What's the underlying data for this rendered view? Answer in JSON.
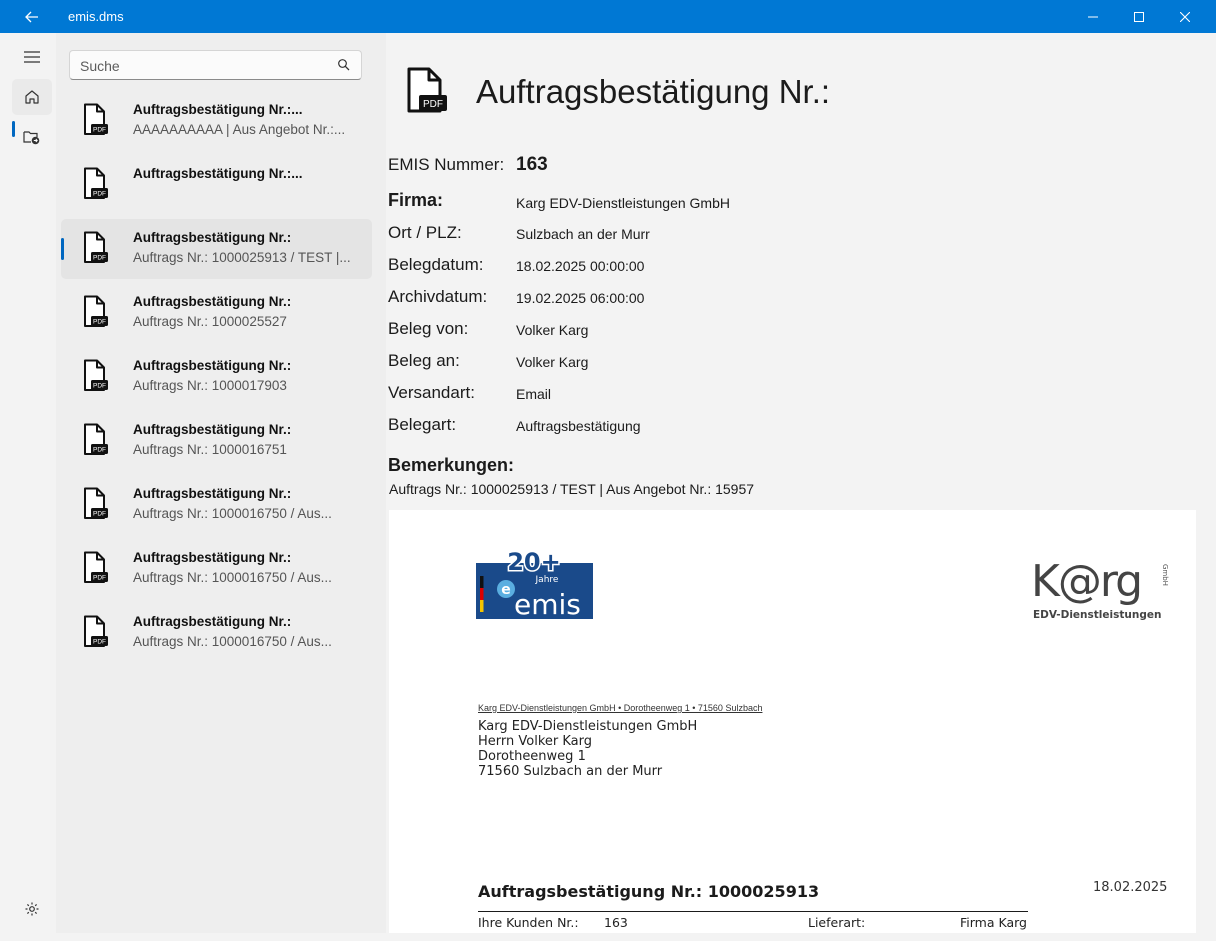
{
  "window": {
    "title": "emis.dms"
  },
  "search": {
    "placeholder": "Suche"
  },
  "list": [
    {
      "title": "Auftragsbestätigung Nr.:...",
      "subtitle": "AAAAAAAAAA | Aus Angebot Nr.:..."
    },
    {
      "title": "Auftragsbestätigung Nr.:...",
      "subtitle": ""
    },
    {
      "title": "Auftragsbestätigung Nr.:",
      "subtitle": "Auftrags Nr.: 1000025913 / TEST |..."
    },
    {
      "title": "Auftragsbestätigung Nr.:",
      "subtitle": "Auftrags Nr.: 1000025527"
    },
    {
      "title": "Auftragsbestätigung Nr.:",
      "subtitle": "Auftrags Nr.: 1000017903"
    },
    {
      "title": "Auftragsbestätigung Nr.:",
      "subtitle": "Auftrags Nr.: 1000016751"
    },
    {
      "title": "Auftragsbestätigung Nr.:",
      "subtitle": "Auftrags Nr.: 1000016750 / Aus..."
    },
    {
      "title": "Auftragsbestätigung Nr.:",
      "subtitle": "Auftrags Nr.: 1000016750 / Aus..."
    },
    {
      "title": "Auftragsbestätigung Nr.:",
      "subtitle": "Auftrags Nr.: 1000016750 / Aus..."
    }
  ],
  "icons": {
    "pdf_badge": "PDF"
  },
  "detail": {
    "title": "Auftragsbestätigung Nr.:",
    "fields": {
      "emis_label": "EMIS Nummer:",
      "emis_value": "163",
      "firma_label": "Firma:",
      "firma_value": "Karg EDV-Dienstleistungen GmbH",
      "ort_label": "Ort / PLZ:",
      "ort_value": "Sulzbach an der Murr",
      "belegdatum_label": "Belegdatum:",
      "belegdatum_value": "18.02.2025 00:00:00",
      "archivdatum_label": "Archivdatum:",
      "archivdatum_value": "19.02.2025 06:00:00",
      "von_label": "Beleg von:",
      "von_value": "Volker Karg",
      "an_label": "Beleg an:",
      "an_value": "Volker Karg",
      "versandart_label": "Versandart:",
      "versandart_value": "Email",
      "belegart_label": "Belegart:",
      "belegart_value": "Auftragsbestätigung"
    },
    "remarks_label": "Bemerkungen:",
    "remarks_value": "Auftrags Nr.: 1000025913 / TEST | Aus Angebot Nr.: 15957"
  },
  "document": {
    "logo_emis_years": "20+",
    "logo_emis_jahre": "Jahre",
    "logo_emis_name": "emis",
    "logo_karg_name": "K@rg",
    "logo_karg_gmbh": "GmbH",
    "logo_karg_sub": "EDV-Dienstleistungen",
    "sender_line": "Karg EDV-Dienstleistungen GmbH • Dorotheenweg 1 • 71560 Sulzbach",
    "address": [
      "Karg EDV-Dienstleistungen GmbH",
      "Herrn Volker Karg",
      "Dorotheenweg 1",
      "71560 Sulzbach an der Murr"
    ],
    "title": "Auftragsbestätigung Nr.: 1000025913",
    "date": "18.02.2025",
    "kunden_label": "Ihre Kunden Nr.:",
    "kunden_value": "163",
    "lieferart_label": "Lieferart:",
    "lieferart_value": "Firma Karg"
  },
  "colors": {
    "accent": "#0078d4",
    "indicator": "#0067c0",
    "emis_blue": "#1a4a8a",
    "karg_blue": "#3a9bd5"
  }
}
